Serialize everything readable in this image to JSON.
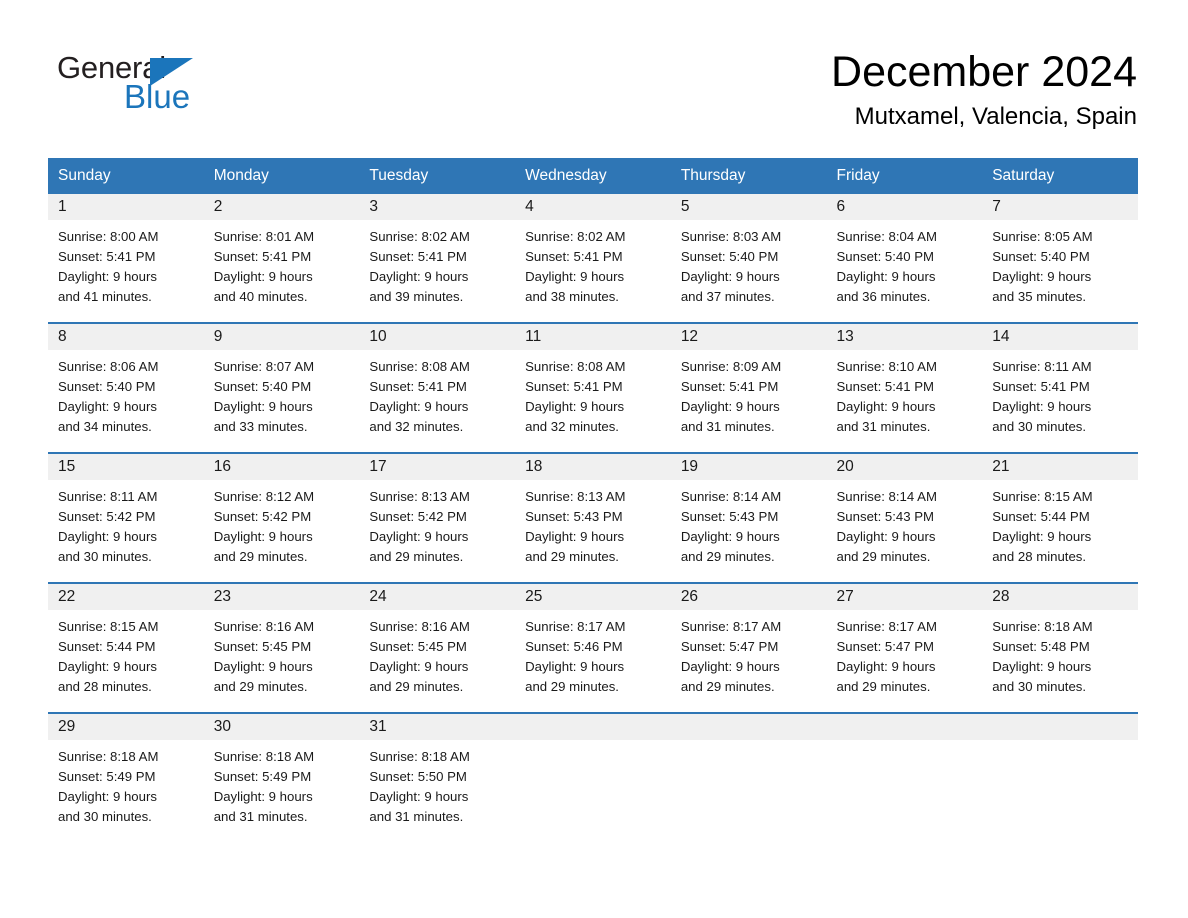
{
  "brand": {
    "name_part1": "General",
    "name_part2": "Blue",
    "accent_color": "#1b75bb"
  },
  "header": {
    "month_title": "December 2024",
    "location": "Mutxamel, Valencia, Spain"
  },
  "theme": {
    "header_blue": "#2f76b5",
    "daynum_band": "#f0f0f0",
    "text_color": "#1a1a1a"
  },
  "weekday_headers": [
    "Sunday",
    "Monday",
    "Tuesday",
    "Wednesday",
    "Thursday",
    "Friday",
    "Saturday"
  ],
  "weeks": [
    [
      {
        "day": "1",
        "sunrise": "Sunrise: 8:00 AM",
        "sunset": "Sunset: 5:41 PM",
        "daylight_line1": "Daylight: 9 hours",
        "daylight_line2": "and 41 minutes."
      },
      {
        "day": "2",
        "sunrise": "Sunrise: 8:01 AM",
        "sunset": "Sunset: 5:41 PM",
        "daylight_line1": "Daylight: 9 hours",
        "daylight_line2": "and 40 minutes."
      },
      {
        "day": "3",
        "sunrise": "Sunrise: 8:02 AM",
        "sunset": "Sunset: 5:41 PM",
        "daylight_line1": "Daylight: 9 hours",
        "daylight_line2": "and 39 minutes."
      },
      {
        "day": "4",
        "sunrise": "Sunrise: 8:02 AM",
        "sunset": "Sunset: 5:41 PM",
        "daylight_line1": "Daylight: 9 hours",
        "daylight_line2": "and 38 minutes."
      },
      {
        "day": "5",
        "sunrise": "Sunrise: 8:03 AM",
        "sunset": "Sunset: 5:40 PM",
        "daylight_line1": "Daylight: 9 hours",
        "daylight_line2": "and 37 minutes."
      },
      {
        "day": "6",
        "sunrise": "Sunrise: 8:04 AM",
        "sunset": "Sunset: 5:40 PM",
        "daylight_line1": "Daylight: 9 hours",
        "daylight_line2": "and 36 minutes."
      },
      {
        "day": "7",
        "sunrise": "Sunrise: 8:05 AM",
        "sunset": "Sunset: 5:40 PM",
        "daylight_line1": "Daylight: 9 hours",
        "daylight_line2": "and 35 minutes."
      }
    ],
    [
      {
        "day": "8",
        "sunrise": "Sunrise: 8:06 AM",
        "sunset": "Sunset: 5:40 PM",
        "daylight_line1": "Daylight: 9 hours",
        "daylight_line2": "and 34 minutes."
      },
      {
        "day": "9",
        "sunrise": "Sunrise: 8:07 AM",
        "sunset": "Sunset: 5:40 PM",
        "daylight_line1": "Daylight: 9 hours",
        "daylight_line2": "and 33 minutes."
      },
      {
        "day": "10",
        "sunrise": "Sunrise: 8:08 AM",
        "sunset": "Sunset: 5:41 PM",
        "daylight_line1": "Daylight: 9 hours",
        "daylight_line2": "and 32 minutes."
      },
      {
        "day": "11",
        "sunrise": "Sunrise: 8:08 AM",
        "sunset": "Sunset: 5:41 PM",
        "daylight_line1": "Daylight: 9 hours",
        "daylight_line2": "and 32 minutes."
      },
      {
        "day": "12",
        "sunrise": "Sunrise: 8:09 AM",
        "sunset": "Sunset: 5:41 PM",
        "daylight_line1": "Daylight: 9 hours",
        "daylight_line2": "and 31 minutes."
      },
      {
        "day": "13",
        "sunrise": "Sunrise: 8:10 AM",
        "sunset": "Sunset: 5:41 PM",
        "daylight_line1": "Daylight: 9 hours",
        "daylight_line2": "and 31 minutes."
      },
      {
        "day": "14",
        "sunrise": "Sunrise: 8:11 AM",
        "sunset": "Sunset: 5:41 PM",
        "daylight_line1": "Daylight: 9 hours",
        "daylight_line2": "and 30 minutes."
      }
    ],
    [
      {
        "day": "15",
        "sunrise": "Sunrise: 8:11 AM",
        "sunset": "Sunset: 5:42 PM",
        "daylight_line1": "Daylight: 9 hours",
        "daylight_line2": "and 30 minutes."
      },
      {
        "day": "16",
        "sunrise": "Sunrise: 8:12 AM",
        "sunset": "Sunset: 5:42 PM",
        "daylight_line1": "Daylight: 9 hours",
        "daylight_line2": "and 29 minutes."
      },
      {
        "day": "17",
        "sunrise": "Sunrise: 8:13 AM",
        "sunset": "Sunset: 5:42 PM",
        "daylight_line1": "Daylight: 9 hours",
        "daylight_line2": "and 29 minutes."
      },
      {
        "day": "18",
        "sunrise": "Sunrise: 8:13 AM",
        "sunset": "Sunset: 5:43 PM",
        "daylight_line1": "Daylight: 9 hours",
        "daylight_line2": "and 29 minutes."
      },
      {
        "day": "19",
        "sunrise": "Sunrise: 8:14 AM",
        "sunset": "Sunset: 5:43 PM",
        "daylight_line1": "Daylight: 9 hours",
        "daylight_line2": "and 29 minutes."
      },
      {
        "day": "20",
        "sunrise": "Sunrise: 8:14 AM",
        "sunset": "Sunset: 5:43 PM",
        "daylight_line1": "Daylight: 9 hours",
        "daylight_line2": "and 29 minutes."
      },
      {
        "day": "21",
        "sunrise": "Sunrise: 8:15 AM",
        "sunset": "Sunset: 5:44 PM",
        "daylight_line1": "Daylight: 9 hours",
        "daylight_line2": "and 28 minutes."
      }
    ],
    [
      {
        "day": "22",
        "sunrise": "Sunrise: 8:15 AM",
        "sunset": "Sunset: 5:44 PM",
        "daylight_line1": "Daylight: 9 hours",
        "daylight_line2": "and 28 minutes."
      },
      {
        "day": "23",
        "sunrise": "Sunrise: 8:16 AM",
        "sunset": "Sunset: 5:45 PM",
        "daylight_line1": "Daylight: 9 hours",
        "daylight_line2": "and 29 minutes."
      },
      {
        "day": "24",
        "sunrise": "Sunrise: 8:16 AM",
        "sunset": "Sunset: 5:45 PM",
        "daylight_line1": "Daylight: 9 hours",
        "daylight_line2": "and 29 minutes."
      },
      {
        "day": "25",
        "sunrise": "Sunrise: 8:17 AM",
        "sunset": "Sunset: 5:46 PM",
        "daylight_line1": "Daylight: 9 hours",
        "daylight_line2": "and 29 minutes."
      },
      {
        "day": "26",
        "sunrise": "Sunrise: 8:17 AM",
        "sunset": "Sunset: 5:47 PM",
        "daylight_line1": "Daylight: 9 hours",
        "daylight_line2": "and 29 minutes."
      },
      {
        "day": "27",
        "sunrise": "Sunrise: 8:17 AM",
        "sunset": "Sunset: 5:47 PM",
        "daylight_line1": "Daylight: 9 hours",
        "daylight_line2": "and 29 minutes."
      },
      {
        "day": "28",
        "sunrise": "Sunrise: 8:18 AM",
        "sunset": "Sunset: 5:48 PM",
        "daylight_line1": "Daylight: 9 hours",
        "daylight_line2": "and 30 minutes."
      }
    ],
    [
      {
        "day": "29",
        "sunrise": "Sunrise: 8:18 AM",
        "sunset": "Sunset: 5:49 PM",
        "daylight_line1": "Daylight: 9 hours",
        "daylight_line2": "and 30 minutes."
      },
      {
        "day": "30",
        "sunrise": "Sunrise: 8:18 AM",
        "sunset": "Sunset: 5:49 PM",
        "daylight_line1": "Daylight: 9 hours",
        "daylight_line2": "and 31 minutes."
      },
      {
        "day": "31",
        "sunrise": "Sunrise: 8:18 AM",
        "sunset": "Sunset: 5:50 PM",
        "daylight_line1": "Daylight: 9 hours",
        "daylight_line2": "and 31 minutes."
      },
      {
        "day": "",
        "sunrise": "",
        "sunset": "",
        "daylight_line1": "",
        "daylight_line2": ""
      },
      {
        "day": "",
        "sunrise": "",
        "sunset": "",
        "daylight_line1": "",
        "daylight_line2": ""
      },
      {
        "day": "",
        "sunrise": "",
        "sunset": "",
        "daylight_line1": "",
        "daylight_line2": ""
      },
      {
        "day": "",
        "sunrise": "",
        "sunset": "",
        "daylight_line1": "",
        "daylight_line2": ""
      }
    ]
  ]
}
